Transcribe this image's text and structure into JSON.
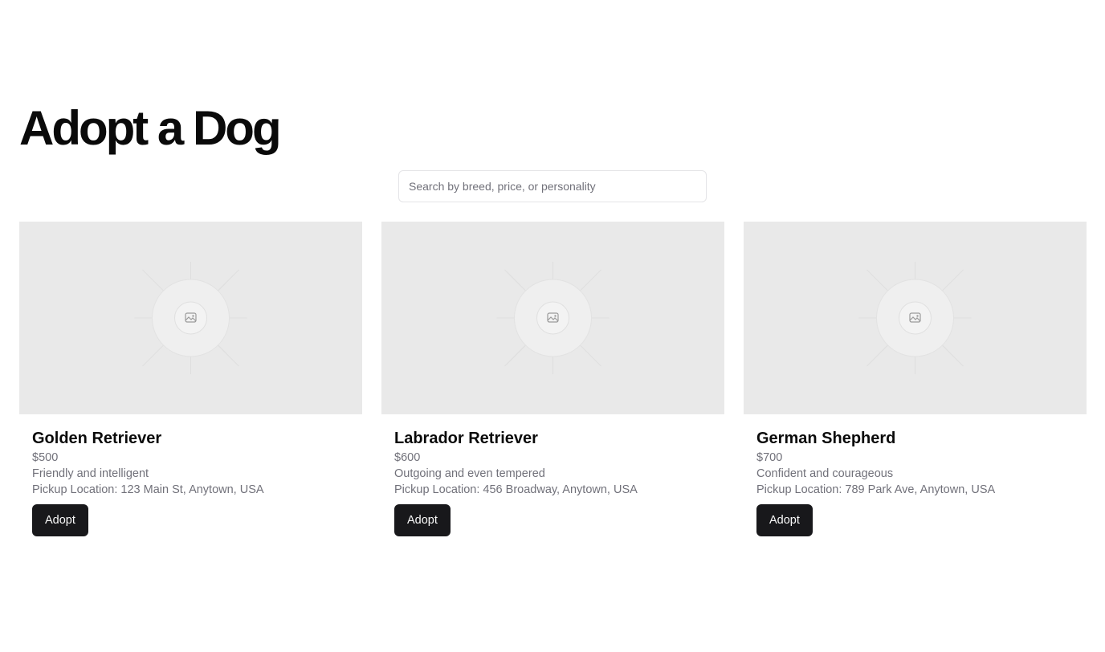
{
  "page": {
    "title": "Adopt a Dog"
  },
  "search": {
    "placeholder": "Search by breed, price, or personality",
    "value": ""
  },
  "dogs": [
    {
      "name": "Golden Retriever",
      "price": "$500",
      "personality": "Friendly and intelligent",
      "pickup": "Pickup Location: 123 Main St, Anytown, USA",
      "button_label": "Adopt",
      "image_icon": "image-placeholder-icon"
    },
    {
      "name": "Labrador Retriever",
      "price": "$600",
      "personality": "Outgoing and even tempered",
      "pickup": "Pickup Location: 456 Broadway, Anytown, USA",
      "button_label": "Adopt",
      "image_icon": "image-placeholder-icon"
    },
    {
      "name": "German Shepherd",
      "price": "$700",
      "personality": "Confident and courageous",
      "pickup": "Pickup Location: 789 Park Ave, Anytown, USA",
      "button_label": "Adopt",
      "image_icon": "image-placeholder-icon"
    }
  ],
  "colors": {
    "button_bg": "#18181b",
    "button_text": "#fafafa",
    "muted_text": "#71717a",
    "placeholder_bg": "#e9e9e9",
    "border": "#e4e4e7"
  }
}
